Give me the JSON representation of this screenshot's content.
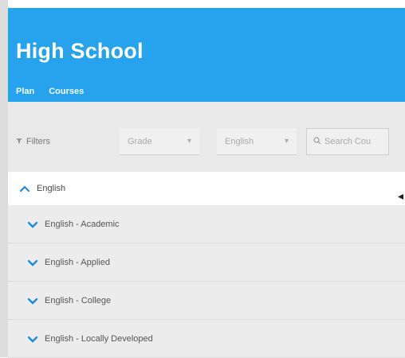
{
  "header": {
    "title": "High School"
  },
  "tabs": [
    {
      "label": "Plan"
    },
    {
      "label": "Courses"
    }
  ],
  "filters": {
    "label": "Filters",
    "grade": {
      "value": "Grade"
    },
    "subject": {
      "value": "English"
    },
    "search": {
      "placeholder": "Search Cou"
    }
  },
  "sections": {
    "main": {
      "label": "English",
      "icon": "chevron-up-icon"
    },
    "items": [
      {
        "label": "English - Academic",
        "icon": "chevron-down-icon"
      },
      {
        "label": "English - Applied",
        "icon": "chevron-down-icon"
      },
      {
        "label": "English - College",
        "icon": "chevron-down-icon"
      },
      {
        "label": "English - Locally Developed",
        "icon": "chevron-down-icon"
      }
    ]
  },
  "colors": {
    "header": "#27a3ee",
    "accent": "#2196f3"
  }
}
